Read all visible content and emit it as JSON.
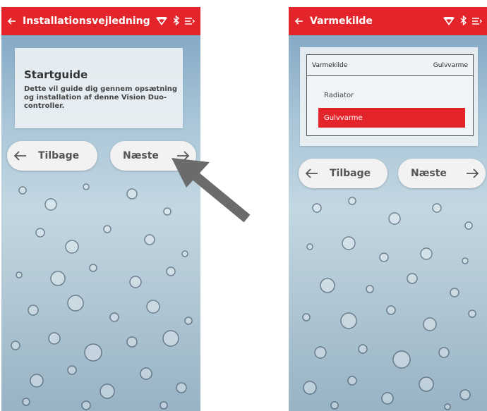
{
  "screens": [
    {
      "title": "Installationsvejledning",
      "card": {
        "heading": "Startguide",
        "text": "Dette vil guide dig gennem opsætning og installation af denne Vision Duo-controller."
      },
      "back_label": "Tilbage",
      "next_label": "Næste"
    },
    {
      "title": "Varmekilde",
      "select": {
        "label": "Varmekilde",
        "value": "Gulvvarme",
        "options": [
          "Radiator",
          "Gulvvarme"
        ],
        "selected_index": 1
      },
      "back_label": "Tilbage",
      "next_label": "Næste"
    }
  ],
  "icons": [
    "back-arrow-icon",
    "wifi-icon",
    "bluetooth-icon",
    "menu-icon",
    "arrow-left-icon",
    "arrow-right-icon",
    "pointer-arrow"
  ],
  "colors": {
    "accent": "#e3252b",
    "button_bg": "#f2f2f2",
    "pointer": "#6b6b6b"
  }
}
